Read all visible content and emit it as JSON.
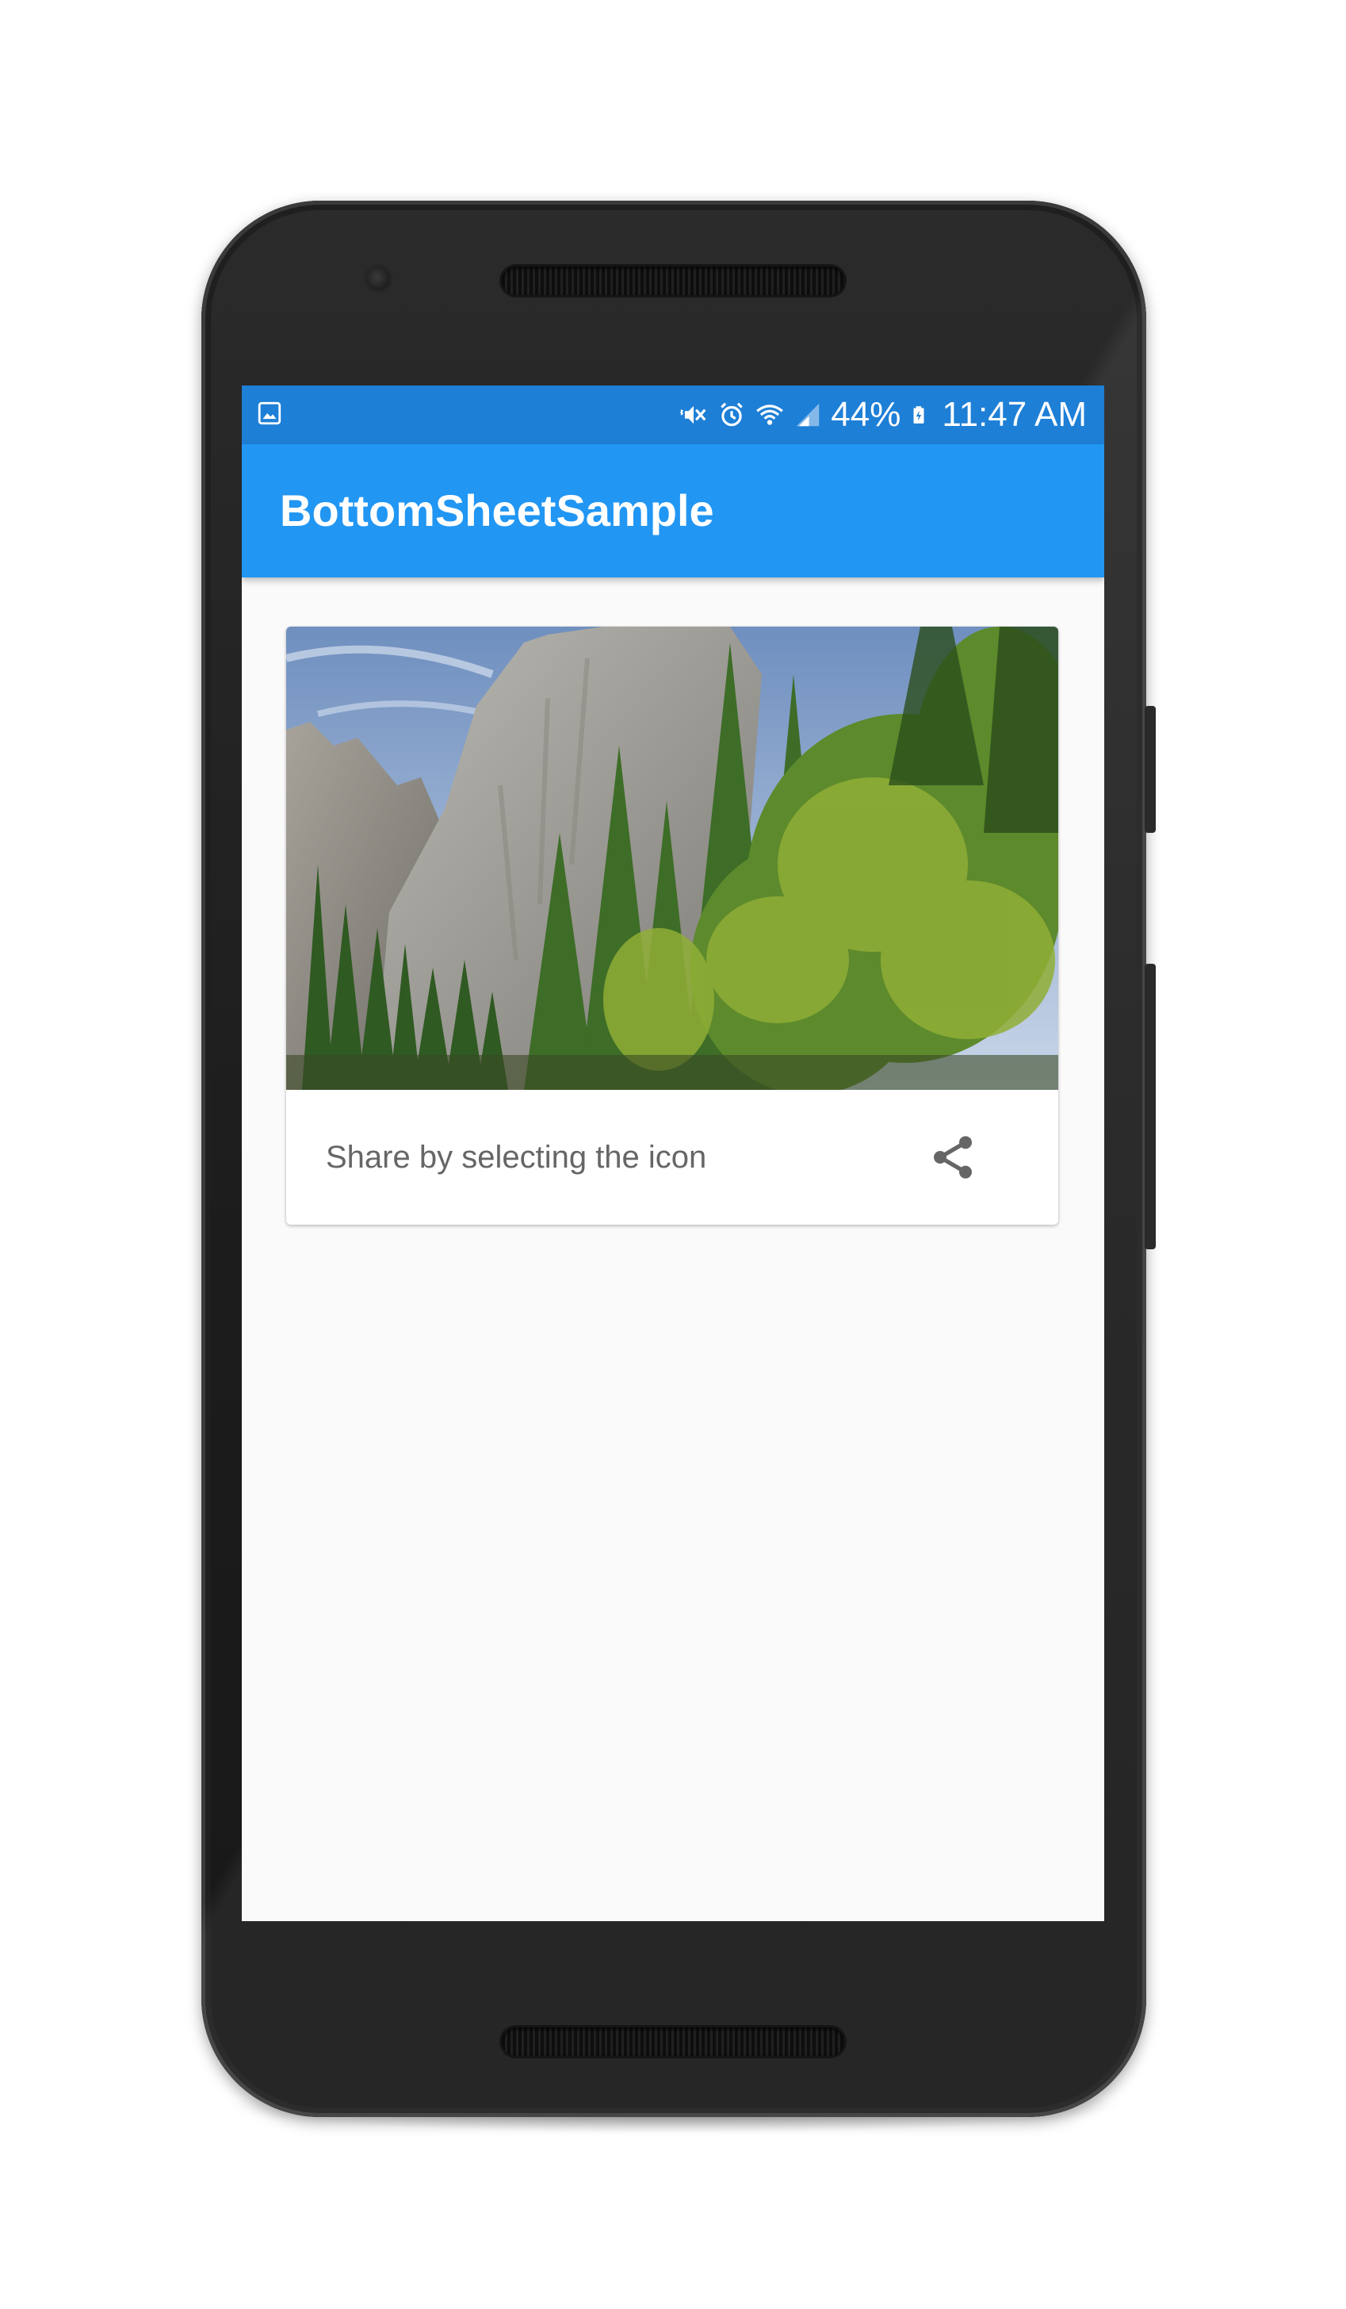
{
  "status_bar": {
    "battery_percent": "44%",
    "time": "11:47 AM",
    "icons": [
      "gallery-icon",
      "mute-vibrate-icon",
      "alarm-icon",
      "wifi-icon",
      "signal-icon",
      "battery-charging-icon"
    ]
  },
  "app_bar": {
    "title": "BottomSheetSample",
    "color": "#2196f3"
  },
  "card": {
    "image": "yosemite-cliff-forest-photo",
    "caption": "Share by selecting the icon",
    "action_icon": "share-icon"
  },
  "colors": {
    "status_bar": "#1e7fd6",
    "background": "#fafafa",
    "caption_text": "#666666",
    "icon": "#666666"
  }
}
